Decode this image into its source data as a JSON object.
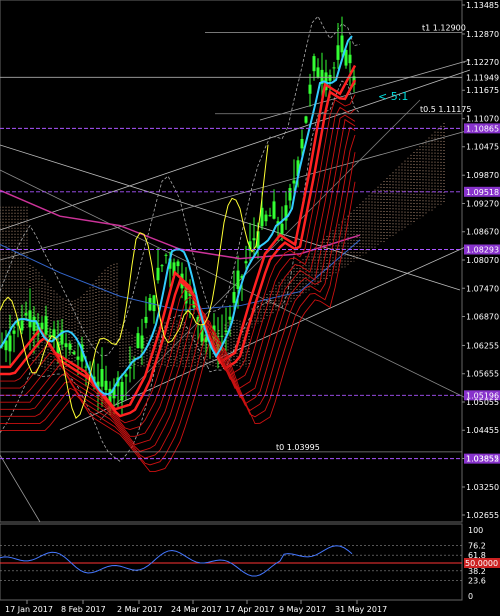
{
  "chart_data": {
    "type": "line",
    "panels": {
      "main": {
        "y_ticks": [
          "1.13485",
          "1.12870",
          "1.12270",
          "1.11675",
          "1.11070",
          "1.10475",
          "1.09870",
          "1.09270",
          "1.08670",
          "1.08070",
          "1.07470",
          "1.06870",
          "1.06255",
          "1.05655",
          "1.05055",
          "1.04455",
          "1.03855",
          "1.03250",
          "1.02655"
        ],
        "ylim": [
          1.02655,
          1.13485
        ]
      },
      "oscillator": {
        "y_ticks": [
          "100",
          "76.2",
          "61.8",
          "38.2",
          "23.6",
          "0"
        ],
        "levels": [
          76.2,
          61.8,
          50,
          38.2,
          23.6
        ],
        "ylim": [
          0,
          100
        ],
        "current_value_label": "50.0000"
      }
    },
    "x_ticks": [
      "17 Jan 2017",
      "8 Feb 2017",
      "2 Mar 2017",
      "24 Mar 2017",
      "17 Apr 2017",
      "9 May 2017",
      "31 May 2017"
    ],
    "price_labels": [
      {
        "text": "1.11949",
        "value": 1.11949,
        "color": "#ffffff"
      },
      {
        "text": "1.10865",
        "value": 1.10865,
        "color": "#cc66ff"
      },
      {
        "text": "1.09518",
        "value": 1.09518,
        "color": "#cc66ff"
      },
      {
        "text": "1.08293",
        "value": 1.08293,
        "color": "#cc66ff"
      },
      {
        "text": "1.05196",
        "value": 1.05196,
        "color": "#cc66ff"
      },
      {
        "text": "1.03852",
        "value": 1.03852,
        "color": "#cc66ff"
      }
    ],
    "level_labels": [
      {
        "text": "t1 1.12900",
        "value": 1.129
      },
      {
        "text": "t0 1.03995",
        "value": 1.03995
      },
      {
        "text": "t0.5 1.11175",
        "value": 1.11175
      }
    ],
    "ratio_label": "< 5:1",
    "colors": {
      "candle": "#33ff33",
      "price_line": "#ffff33",
      "fast_ma": "#33ccff",
      "slow_ma": "#ff2222",
      "long_ma": "#cc3399",
      "cloud": "#ffccaa",
      "level_purple": "#aa55ff",
      "osc_line": "#4477ff"
    },
    "series_close": [
      {
        "d": "17 Jan 2017",
        "v": 1.064
      },
      {
        "d": "8 Feb 2017",
        "v": 1.066
      },
      {
        "d": "2 Mar 2017",
        "v": 1.054
      },
      {
        "d": "24 Mar 2017",
        "v": 1.08
      },
      {
        "d": "17 Apr 2017",
        "v": 1.064
      },
      {
        "d": "9 May 2017",
        "v": 1.092
      },
      {
        "d": "31 May 2017",
        "v": 1.12
      }
    ]
  }
}
